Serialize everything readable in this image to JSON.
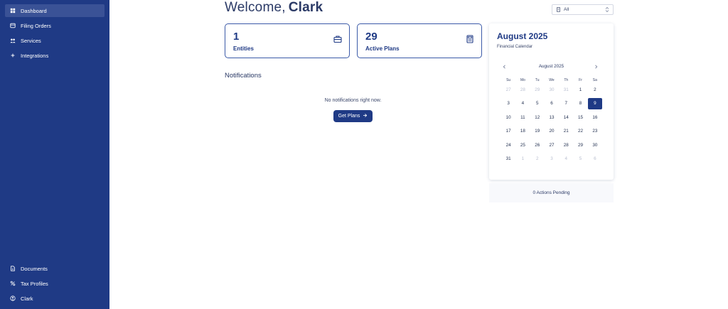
{
  "sidebar": {
    "items": [
      {
        "label": "Dashboard",
        "icon": "dashboard-icon",
        "active": true
      },
      {
        "label": "Filing Orders",
        "icon": "filing-icon",
        "active": false
      },
      {
        "label": "Services",
        "icon": "services-icon",
        "active": false
      },
      {
        "label": "Integrations",
        "icon": "integrations-icon",
        "active": false
      }
    ],
    "bottom_items": [
      {
        "label": "Documents",
        "icon": "document-icon"
      },
      {
        "label": "Tax Profiles",
        "icon": "tax-icon"
      },
      {
        "label": "Clark",
        "icon": "user-icon"
      }
    ]
  },
  "header": {
    "welcome": "Welcome,",
    "user": "Clark"
  },
  "filter": {
    "value": "All"
  },
  "stats": [
    {
      "value": "1",
      "label": "Entities",
      "icon": "briefcase-icon"
    },
    {
      "value": "29",
      "label": "Active Plans",
      "icon": "calculator-icon"
    }
  ],
  "notifications": {
    "title": "Notifications",
    "empty_text": "No notifications right now.",
    "button": "Get Plans"
  },
  "calendar": {
    "title": "August 2025",
    "subtitle": "Financial Calendar",
    "month_label": "August 2025",
    "weekdays": [
      "Su",
      "Mo",
      "Tu",
      "We",
      "Th",
      "Fr",
      "Sa"
    ],
    "weeks": [
      [
        "27",
        "28",
        "29",
        "30",
        "31",
        "1",
        "2"
      ],
      [
        "3",
        "4",
        "5",
        "6",
        "7",
        "8",
        "9"
      ],
      [
        "10",
        "11",
        "12",
        "13",
        "14",
        "15",
        "16"
      ],
      [
        "17",
        "18",
        "19",
        "20",
        "21",
        "22",
        "23"
      ],
      [
        "24",
        "25",
        "26",
        "27",
        "28",
        "29",
        "30"
      ],
      [
        "31",
        "1",
        "2",
        "3",
        "4",
        "5",
        "6"
      ]
    ],
    "muted": [
      [
        0,
        0
      ],
      [
        0,
        1
      ],
      [
        0,
        2
      ],
      [
        0,
        3
      ],
      [
        0,
        4
      ],
      [
        5,
        1
      ],
      [
        5,
        2
      ],
      [
        5,
        3
      ],
      [
        5,
        4
      ],
      [
        5,
        5
      ],
      [
        5,
        6
      ]
    ],
    "selected": [
      1,
      6
    ]
  },
  "pending": {
    "text": "0 Actions Pending"
  },
  "colors": {
    "sidebar": "#1f3a85",
    "accent": "#1f3a85"
  }
}
